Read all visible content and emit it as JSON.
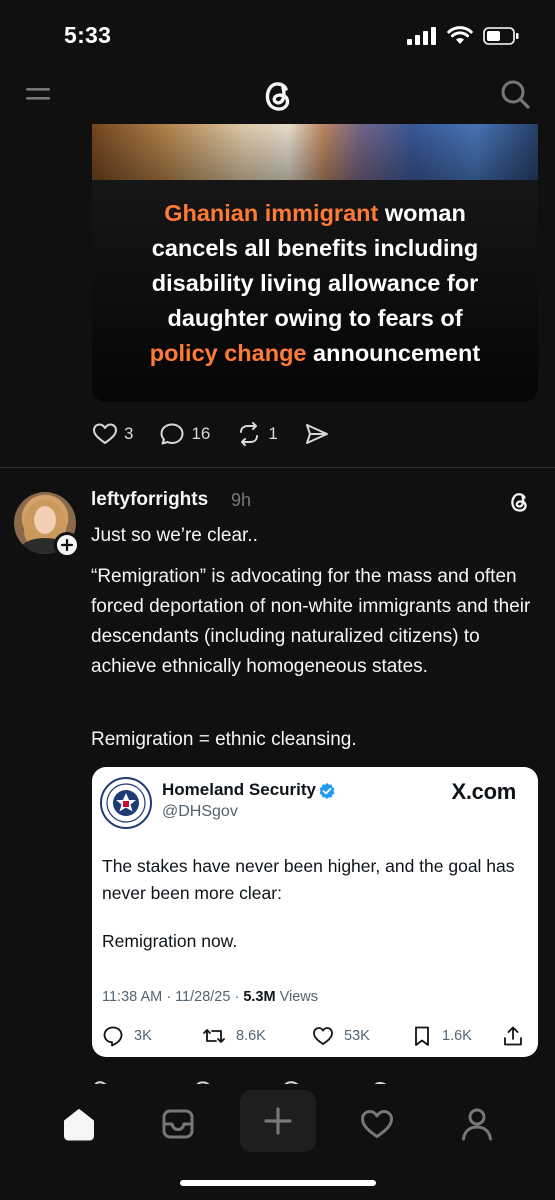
{
  "status_bar": {
    "time": "5:33"
  },
  "header": {
    "logo": "threads-logo-icon"
  },
  "post1": {
    "headline": [
      [
        {
          "t": "Ghanian immigrant",
          "c": "orange"
        },
        {
          "t": " woman",
          "c": "white"
        }
      ],
      [
        {
          "t": "cancels all benefits including",
          "c": "white"
        }
      ],
      [
        {
          "t": "disability living allowance for",
          "c": "white"
        }
      ],
      [
        {
          "t": "daughter owing to fears of",
          "c": "white"
        }
      ],
      [
        {
          "t": "policy change",
          "c": "orange"
        },
        {
          "t": " announcement",
          "c": "white"
        }
      ]
    ],
    "likes": "3",
    "replies": "16",
    "reposts": "1"
  },
  "post2": {
    "username": "leftyforrights",
    "time": "9h",
    "paragraphs": [
      "Just so we’re clear..",
      "“Remigration” is advocating for the mass and often forced deportation of non-white immigrants and their descendants (including naturalized citizens) to achieve ethnically homogeneous states.",
      "Remigration = ethnic cleansing."
    ]
  },
  "embed": {
    "name": "Homeland Security",
    "handle": "@DHSgov",
    "source": "X.com",
    "text": "The stakes have never been higher, and the goal has never been more clear:",
    "text2": "Remigration now.",
    "meta_time": "11:38 AM · 11/28/25 · ",
    "meta_views_count": "5.3M",
    "meta_views_label": " Views",
    "replies": "3K",
    "reposts": "8.6K",
    "likes": "53K",
    "bookmarks": "1.6K"
  },
  "colors": {
    "background": "#101010",
    "accent_orange": "#ff7a36",
    "verified_blue": "#1d9bf0"
  }
}
